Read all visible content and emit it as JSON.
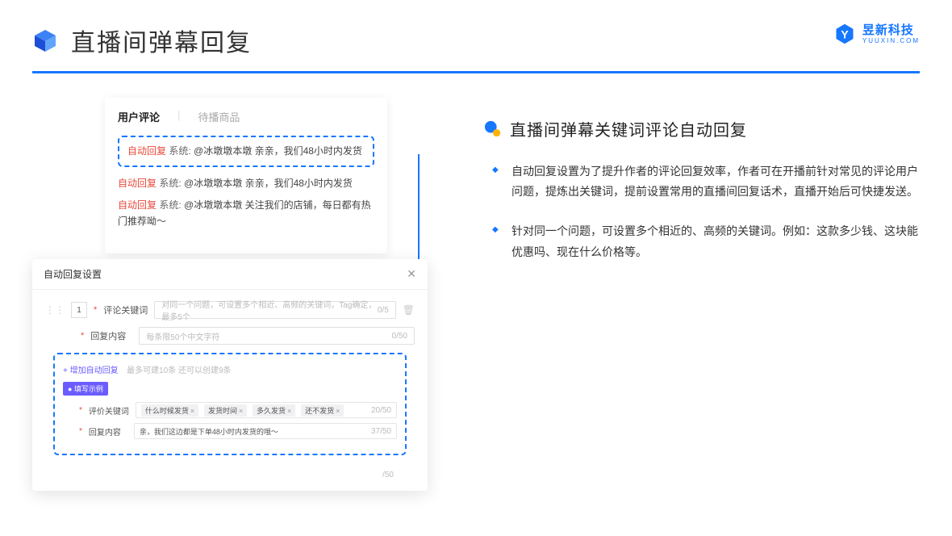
{
  "header": {
    "title": "直播间弹幕回复"
  },
  "brand": {
    "cn": "昱新科技",
    "en": "YUUXIN.COM"
  },
  "comments": {
    "tab_active": "用户评论",
    "tab_inactive": "待播商品",
    "auto_label": "自动回复",
    "sys_label": "系统:",
    "list": [
      {
        "msg": "@冰墩墩本墩 亲亲，我们48小时内发货"
      },
      {
        "msg": "@冰墩墩本墩 亲亲，我们48小时内发货"
      },
      {
        "msg": "@冰墩墩本墩 关注我们的店铺，每日都有热门推荐呦～"
      }
    ]
  },
  "settings": {
    "title": "自动回复设置",
    "close": "✕",
    "idx": "1",
    "keyword_label": "评论关键词",
    "keyword_placeholder": "对同一个问题，可设置多个相近、高频的关键词，Tag确定，最多5个",
    "keyword_counter": "0/5",
    "reply_label": "回复内容",
    "reply_placeholder": "每条限50个中文字符",
    "reply_counter": "0/50",
    "add_link": "+ 增加自动回复",
    "add_hint": "最多可建10条 还可以创建9条",
    "example_badge": "● 填写示例",
    "ex_keyword_label": "评价关键词",
    "ex_reply_label": "回复内容",
    "ex_tags": [
      "什么时候发货",
      "发货时间",
      "多久发货",
      "还不发货"
    ],
    "ex_tag_counter": "20/50",
    "ex_reply_text": "亲，我们这边都是下单48小时内发货的哦～",
    "ex_reply_counter": "37/50",
    "bottom_counter": "/50"
  },
  "right": {
    "section_title": "直播间弹幕关键词评论自动回复",
    "bullets": [
      "自动回复设置为了提升作者的评论回复效率，作者可在开播前针对常见的评论用户问题，提炼出关键词，提前设置常用的直播间回复话术，直播开始后可快捷发送。",
      "针对同一个问题，可设置多个相近的、高频的关键词。例如：这款多少钱、这块能优惠吗、现在什么价格等。"
    ]
  }
}
